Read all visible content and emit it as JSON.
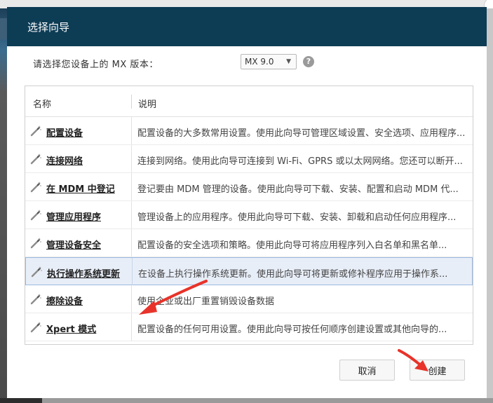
{
  "dialog": {
    "title": "选择向导",
    "version_label": "请选择您设备上的 MX 版本：",
    "version_value": "MX 9.0",
    "help_glyph": "?"
  },
  "list": {
    "columns": {
      "name": "名称",
      "description": "说明"
    },
    "rows": [
      {
        "name": "配置设备",
        "description": "配置设备的大多数常用设置。使用此向导可管理区域设置、安全选项、应用程序..."
      },
      {
        "name": "连接网络",
        "description": "连接到网络。使用此向导可连接到 Wi-Fi、GPRS 或以太网网络。您还可以断开..."
      },
      {
        "name": "在 MDM 中登记",
        "description": "登记要由 MDM 管理的设备。使用此向导可下载、安装、配置和启动 MDM 代..."
      },
      {
        "name": "管理应用程序",
        "description": "管理设备上的应用程序。使用此向导可下载、安装、卸载和启动任何应用程序..."
      },
      {
        "name": "管理设备安全",
        "description": "配置设备的安全选项和策略。使用此向导可将应用程序列入白名单和黑名单..."
      },
      {
        "name": "执行操作系统更新",
        "description": "在设备上执行操作系统更新。使用此向导可将更新或修补程序应用于操作系..."
      },
      {
        "name": "擦除设备",
        "description": "使用企业或出厂重置销毁设备数据"
      },
      {
        "name": "Xpert 模式",
        "description": "配置设备的任何可用设置。使用此向导可按任何顺序创建设置或其他向导的..."
      }
    ],
    "selected_index": 5
  },
  "buttons": {
    "cancel": "取消",
    "create": "创建"
  },
  "colors": {
    "titlebar": "#0d3c55",
    "selection": "#e8eef8",
    "annotation_arrow": "#e8332a"
  },
  "icons": {
    "row_icon": "magic-wand-icon",
    "help": "help-icon",
    "dropdown": "chevron-down-icon"
  }
}
